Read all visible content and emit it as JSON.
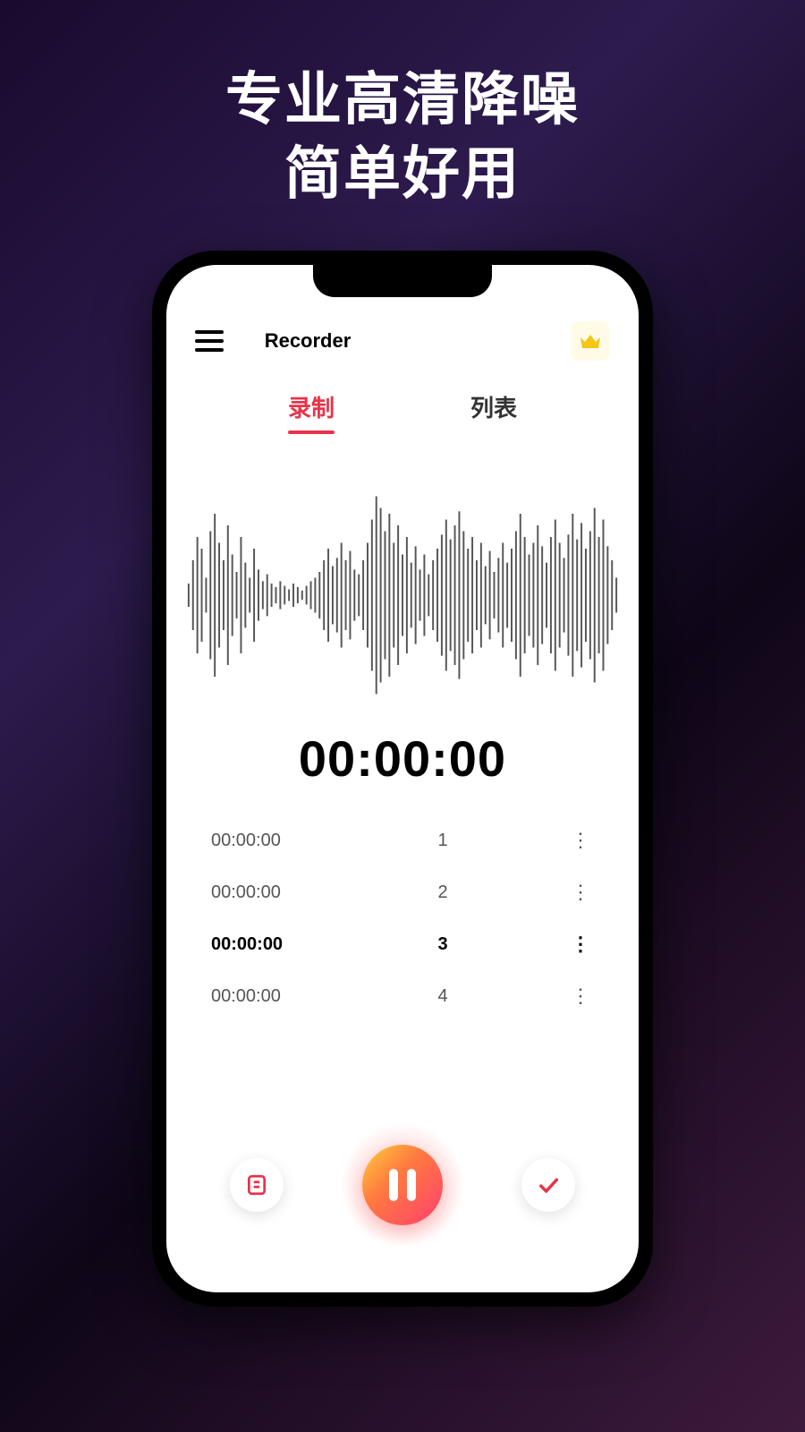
{
  "headline": {
    "line1": "专业高清降噪",
    "line2": "简单好用"
  },
  "header": {
    "title": "Recorder"
  },
  "tabs": {
    "record": "录制",
    "list": "列表"
  },
  "timer": "00:00:00",
  "marks": [
    {
      "time": "00:00:00",
      "index": "1"
    },
    {
      "time": "00:00:00",
      "index": "2"
    },
    {
      "time": "00:00:00",
      "index": "3"
    },
    {
      "time": "00:00:00",
      "index": "4"
    }
  ],
  "colors": {
    "accent": "#e8334a",
    "crown": "#f5c518"
  }
}
